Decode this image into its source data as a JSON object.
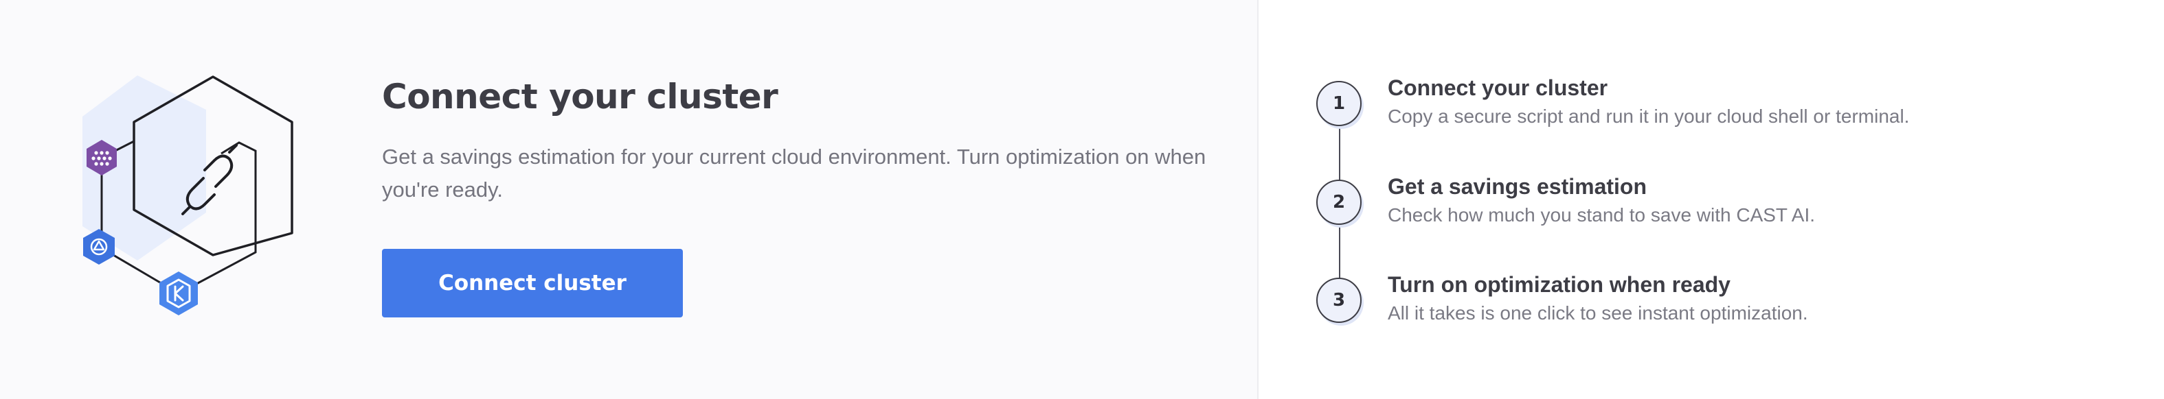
{
  "intro": {
    "title": "Connect your cluster",
    "subtitle": "Get a savings estimation for your current cloud environment. Turn optimization on when you're ready.",
    "button_label": "Connect cluster"
  },
  "colors": {
    "primary_button": "#4279e8",
    "badge_purple": "#7d4ea5",
    "badge_blue": "#3c72de",
    "badge_light_blue": "#4a86ec",
    "hex_backdrop": "#e8eefc"
  },
  "icons": {
    "illustration": "cluster-hexagon-link-icon",
    "badge_1": "purple-hex-grid-icon",
    "badge_2": "blue-hex-helm-icon",
    "badge_3": "light-blue-hex-k-icon"
  },
  "steps": [
    {
      "number": "1",
      "title": "Connect your cluster",
      "description": "Copy a secure script and run it in your cloud shell or terminal."
    },
    {
      "number": "2",
      "title": "Get a savings estimation",
      "description": "Check how much you stand to save with CAST AI."
    },
    {
      "number": "3",
      "title": "Turn on optimization when ready",
      "description": "All it takes is one click to see instant optimization."
    }
  ]
}
